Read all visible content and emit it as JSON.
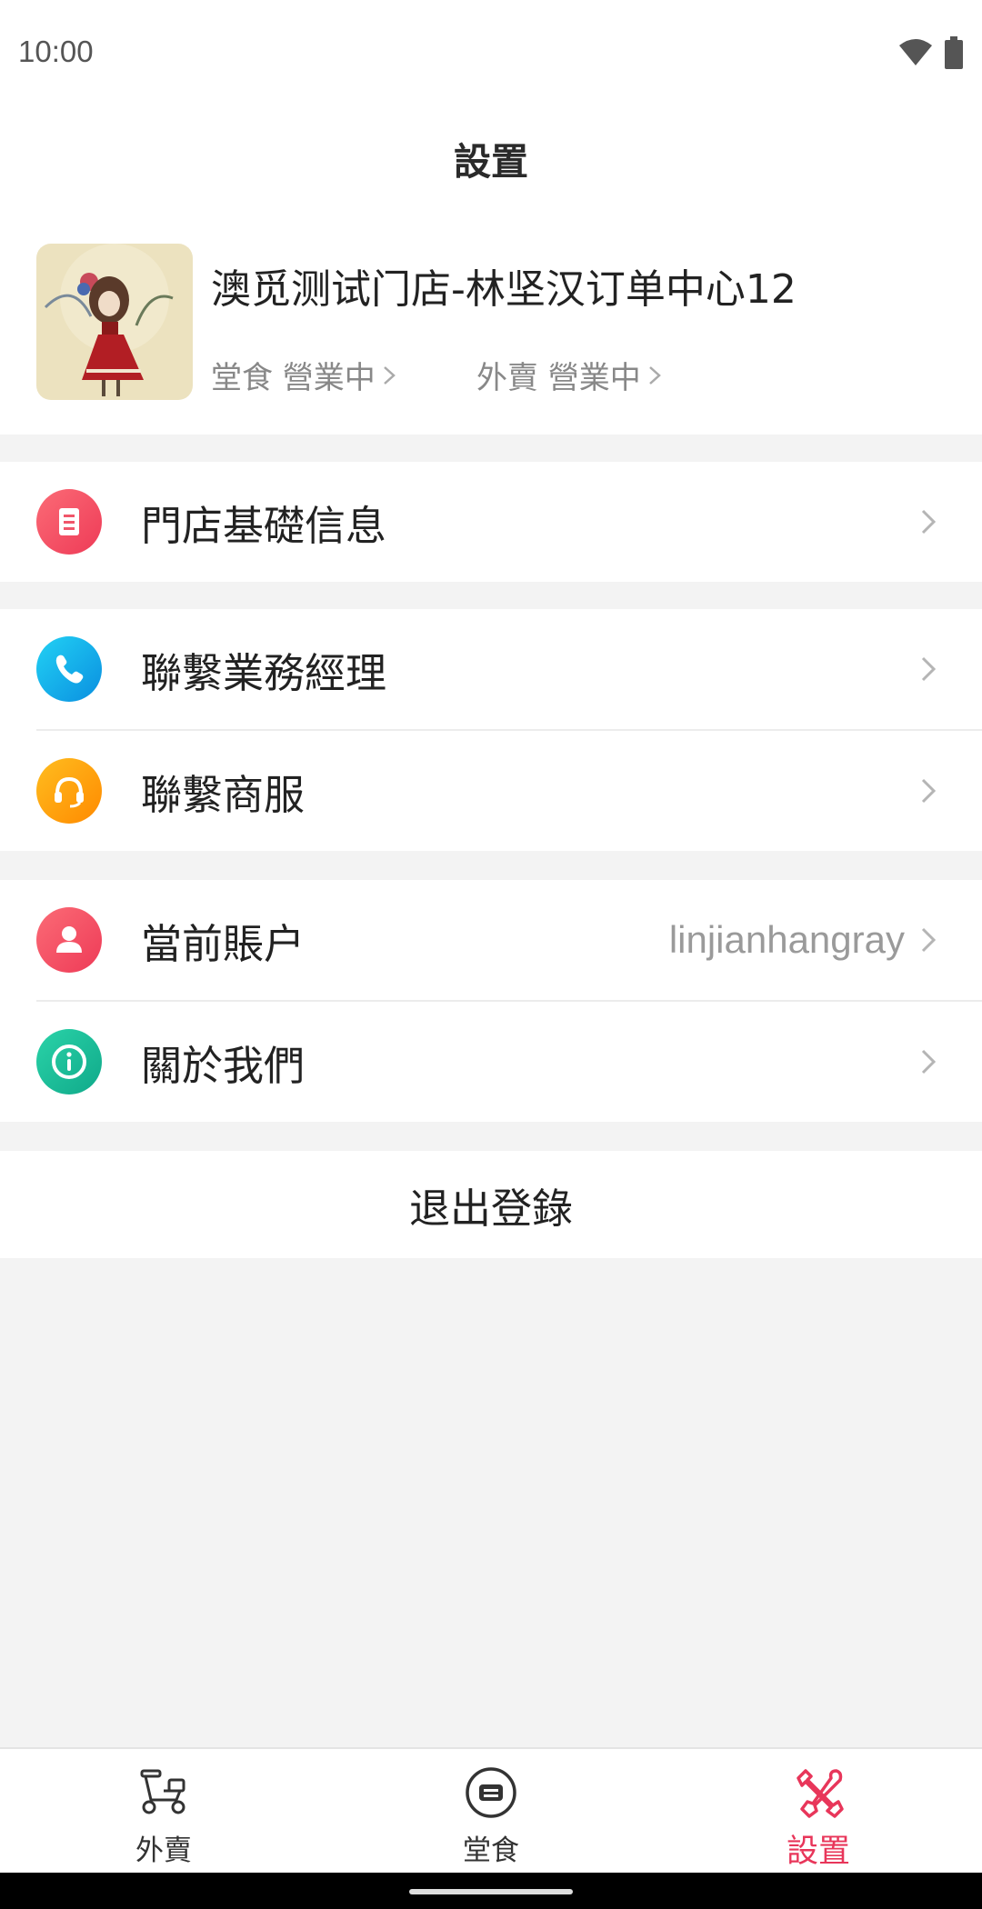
{
  "status_bar": {
    "time": "10:00"
  },
  "header": {
    "title": "設置"
  },
  "store": {
    "name": "澳觅测试门店-林坚汉订单中心12",
    "dine_in_status": "堂食 營業中",
    "takeout_status": "外賣 營業中"
  },
  "menu": {
    "store_info": {
      "label": "門店基礎信息",
      "icon": "document-icon",
      "color": "#f0566a"
    },
    "contact_manager": {
      "label": "聯繫業務經理",
      "icon": "phone-icon",
      "color": "#12b5ea"
    },
    "contact_service": {
      "label": "聯繫商服",
      "icon": "headset-icon",
      "color": "#ffa20a"
    },
    "current_account": {
      "label": "當前賬户",
      "value": "linjianhangray",
      "icon": "user-icon",
      "color": "#f0566a"
    },
    "about_us": {
      "label": "關於我們",
      "icon": "info-icon",
      "color": "#1cbf9a"
    }
  },
  "logout": {
    "label": "退出登錄"
  },
  "tabs": [
    {
      "label": "外賣",
      "icon": "scooter-icon",
      "active": false
    },
    {
      "label": "堂食",
      "icon": "dine-in-icon",
      "active": false
    },
    {
      "label": "設置",
      "icon": "tools-icon",
      "active": true
    }
  ],
  "colors": {
    "accent": "#e8365a",
    "background": "#f3f3f3"
  }
}
